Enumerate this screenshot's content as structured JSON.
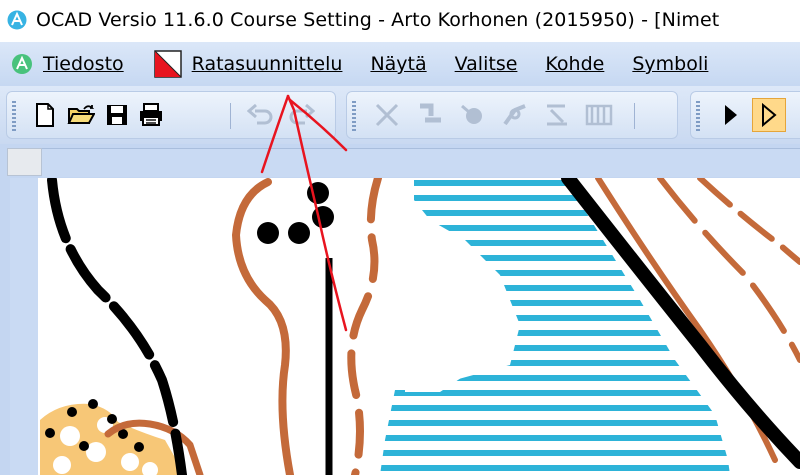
{
  "window": {
    "title": "OCAD Versio 11.6.0  Course Setting - Arto Korhonen (2015950) - [Nimet"
  },
  "menubar": {
    "items": [
      {
        "label": "Tiedosto",
        "id": "tiedosto"
      },
      {
        "label": "Ratasuunnittelu",
        "id": "ratasuunnittelu"
      },
      {
        "label": "Näytä",
        "id": "nayta"
      },
      {
        "label": "Valitse",
        "id": "valitse"
      },
      {
        "label": "Kohde",
        "id": "kohde"
      },
      {
        "label": "Symboli",
        "id": "symboli"
      }
    ]
  },
  "toolbar": {
    "buttons": [
      {
        "icon": "new-file-icon"
      },
      {
        "icon": "open-folder-icon"
      },
      {
        "icon": "save-icon"
      },
      {
        "icon": "print-icon"
      },
      {
        "icon": "undo-icon"
      },
      {
        "icon": "redo-icon"
      },
      {
        "icon": "delete-icon"
      },
      {
        "icon": "split-icon"
      },
      {
        "icon": "rotate-icon"
      },
      {
        "icon": "reshape-icon"
      },
      {
        "icon": "align-icon"
      },
      {
        "icon": "text-icon"
      },
      {
        "icon": "select-arrow-icon"
      },
      {
        "icon": "edit-arrow-icon"
      }
    ]
  },
  "colors": {
    "menubar": "#c6d8f2",
    "toolbar": "#c9d9f1",
    "map_brown": "#c46a3a",
    "map_blue": "#2db3d8",
    "map_black": "#000000",
    "map_yellow": "#f7c777",
    "annotation_red": "#e8141f"
  }
}
